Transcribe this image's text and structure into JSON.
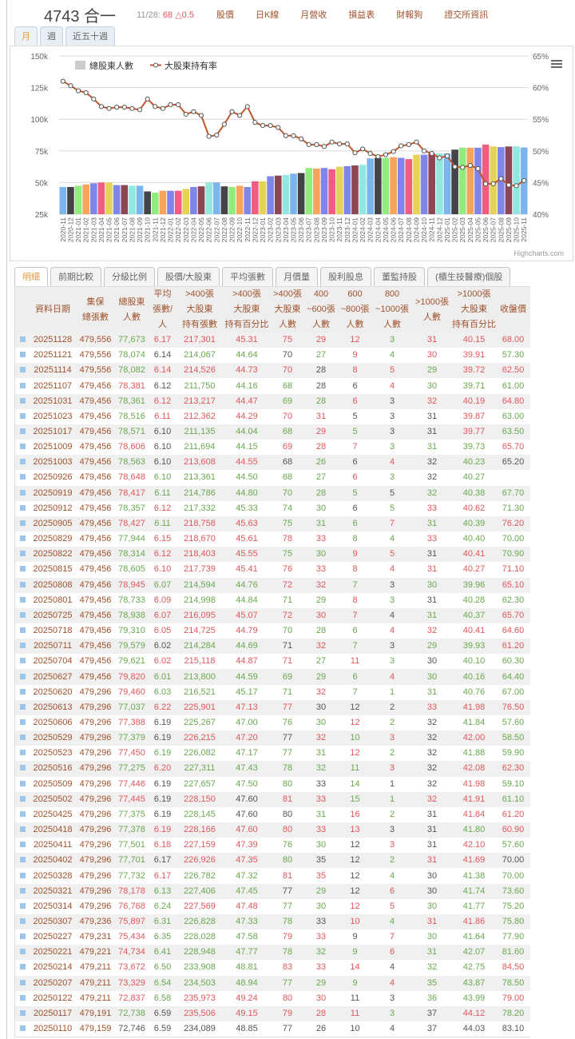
{
  "header": {
    "title": "4743 合一",
    "quote_date": "11/28:",
    "quote_value": "68 △0.5",
    "links": [
      "股價",
      "日K線",
      "月營收",
      "損益表",
      "財報狗",
      "證交所資訊"
    ]
  },
  "period_tabs": [
    {
      "label": "月",
      "active": true
    },
    {
      "label": "週",
      "active": false
    },
    {
      "label": "近五十週",
      "active": false
    }
  ],
  "chart_data": {
    "type": "bar+line",
    "credit": "Highcharts.com",
    "legend": {
      "placement": "top-left",
      "items": [
        "總股東人數",
        "大股東持有率"
      ]
    },
    "line_color": "#c0562c",
    "bar_colors": [
      "#7cb5ec",
      "#434348",
      "#90ed7d",
      "#f7a35c",
      "#8085e9",
      "#f15c80",
      "#e4d354",
      "#8085e8",
      "#8d4653",
      "#91e8e1"
    ],
    "grid": true,
    "y_left": {
      "min": 25000,
      "max": 150000,
      "ticks": [
        "25k",
        "50k",
        "75k",
        "100k",
        "125k",
        "150k"
      ],
      "tick_values": [
        25000,
        50000,
        75000,
        100000,
        125000,
        150000
      ]
    },
    "y_right": {
      "min": 40,
      "max": 65,
      "ticks": [
        "40%",
        "45%",
        "50%",
        "55%",
        "60%",
        "65%"
      ],
      "tick_values": [
        40,
        45,
        50,
        55,
        60,
        65
      ]
    },
    "categories": [
      "2020-11",
      "2020-12",
      "2021-01",
      "2021-02",
      "2021-03",
      "2021-04",
      "2021-05",
      "2021-06",
      "2021-07",
      "2021-08",
      "2021-09",
      "2021-10",
      "2021-11",
      "2021-12",
      "2022-01",
      "2022-02",
      "2022-03",
      "2022-04",
      "2022-05",
      "2022-06",
      "2022-07",
      "2022-08",
      "2022-09",
      "2022-10",
      "2022-11",
      "2022-12",
      "2023-01",
      "2023-02",
      "2023-03",
      "2023-04",
      "2023-05",
      "2023-06",
      "2023-07",
      "2023-08",
      "2023-09",
      "2023-10",
      "2023-11",
      "2023-12",
      "2024-01",
      "2024-02",
      "2024-03",
      "2024-04",
      "2024-05",
      "2024-06",
      "2024-07",
      "2024-08",
      "2024-09",
      "2024-10",
      "2024-11",
      "2024-12",
      "2025-01",
      "2025-02",
      "2025-03",
      "2025-04",
      "2025-05",
      "2025-06",
      "2025-07",
      "2025-08",
      "2025-09",
      "2025-10",
      "2025-11"
    ],
    "series": [
      {
        "name": "總股東人數",
        "type": "bar",
        "axis": "left",
        "values": [
          46500,
          46500,
          47500,
          48500,
          49500,
          50000,
          50000,
          48000,
          48000,
          47500,
          47500,
          43000,
          42000,
          43500,
          43500,
          43500,
          45000,
          46500,
          47000,
          50000,
          50000,
          47000,
          46500,
          47500,
          46500,
          51000,
          51000,
          55000,
          55500,
          56000,
          57000,
          57500,
          61500,
          61000,
          61500,
          60500,
          62500,
          63000,
          63500,
          64000,
          69000,
          69500,
          69500,
          70000,
          69500,
          68500,
          72000,
          72000,
          73000,
          73000,
          73000,
          76000,
          77500,
          77500,
          77500,
          80000,
          78500,
          78000,
          78500,
          78500,
          77673
        ]
      },
      {
        "name": "大股東持有率",
        "type": "line",
        "axis": "right",
        "values": [
          61.0,
          60.3,
          59.5,
          59.2,
          58.2,
          57.0,
          56.7,
          56.9,
          56.9,
          56.7,
          56.5,
          58.2,
          57.0,
          56.7,
          57.3,
          57.3,
          55.8,
          56.2,
          55.6,
          52.3,
          52.5,
          54.2,
          56.2,
          55.6,
          57.0,
          54.5,
          54.0,
          54.0,
          53.7,
          52.4,
          52.4,
          51.9,
          51.0,
          51.0,
          50.7,
          51.4,
          51.1,
          51.1,
          49.7,
          50.3,
          49.6,
          49.1,
          49.4,
          49.9,
          50.8,
          51.0,
          51.4,
          50.0,
          49.6,
          48.9,
          49.2,
          47.5,
          47.4,
          47.7,
          47.2,
          44.8,
          44.8,
          45.6,
          44.6,
          44.5,
          45.31
        ]
      }
    ]
  },
  "table_tabs": [
    {
      "label": "明細",
      "active": true
    },
    {
      "label": "前期比較"
    },
    {
      "label": "分級比例"
    },
    {
      "label": "股價/大股東"
    },
    {
      "label": "平均張數"
    },
    {
      "label": "月價量"
    },
    {
      "label": "股利股息"
    },
    {
      "label": "董監持股"
    },
    {
      "label": "(櫃生技醫療)個股"
    }
  ],
  "table": {
    "columns": [
      "資料日期",
      "集保\n總張數",
      "總股東\n人數",
      "平均\n張數/人",
      ">400張\n大股東\n持有張數",
      ">400張\n大股東\n持有百分比",
      ">400張\n大股東\n人數",
      "400\n~600張\n人數",
      "600\n~800張\n人數",
      "800\n~1000張\n人數",
      ">1000張\n人數",
      ">1000張\n大股東\n持有百分比",
      "收盤價"
    ],
    "rows": [
      [
        "20251128",
        "479,556",
        "77,673",
        "6.17",
        "217,301",
        "45.31",
        "75",
        "29",
        "12",
        "3",
        "31",
        "40.15",
        "68.00"
      ],
      [
        "20251121",
        "479,556",
        "78,074",
        "6.14",
        "214,067",
        "44.64",
        "70",
        "27",
        "9",
        "4",
        "30",
        "39.91",
        "57.30"
      ],
      [
        "20251114",
        "479,556",
        "78,082",
        "6.14",
        "214,526",
        "44.73",
        "70",
        "28",
        "8",
        "5",
        "29",
        "39.72",
        "62.50"
      ],
      [
        "20251107",
        "479,456",
        "78,381",
        "6.12",
        "211,750",
        "44.16",
        "68",
        "28",
        "6",
        "4",
        "30",
        "39.71",
        "61.00"
      ],
      [
        "20251031",
        "479,456",
        "78,361",
        "6.12",
        "213,217",
        "44.47",
        "69",
        "28",
        "6",
        "3",
        "32",
        "40.19",
        "64.80"
      ],
      [
        "20251023",
        "479,456",
        "78,516",
        "6.11",
        "212,362",
        "44.29",
        "70",
        "31",
        "5",
        "3",
        "31",
        "39.87",
        "63.00"
      ],
      [
        "20251017",
        "479,456",
        "78,571",
        "6.10",
        "211,135",
        "44.04",
        "68",
        "29",
        "5",
        "3",
        "31",
        "39.77",
        "63.50"
      ],
      [
        "20251009",
        "479,456",
        "78,606",
        "6.10",
        "211,694",
        "44.15",
        "69",
        "28",
        "7",
        "3",
        "31",
        "39.73",
        "65.70"
      ],
      [
        "20251003",
        "479,456",
        "78,563",
        "6.10",
        "213,608",
        "44.55",
        "68",
        "26",
        "6",
        "4",
        "32",
        "40.23",
        "65.20"
      ],
      [
        "20250926",
        "479,456",
        "78,648",
        "6.10",
        "213,361",
        "44.50",
        "68",
        "27",
        "6",
        "3",
        "32",
        "40.27",
        ""
      ],
      [
        "20250919",
        "479,456",
        "78,417",
        "6.11",
        "214,786",
        "44.80",
        "70",
        "28",
        "5",
        "5",
        "32",
        "40.38",
        "67.70"
      ],
      [
        "20250912",
        "479,456",
        "78,357",
        "6.12",
        "217,332",
        "45.33",
        "74",
        "30",
        "6",
        "5",
        "33",
        "40.62",
        "71.30"
      ],
      [
        "20250905",
        "479,456",
        "78,427",
        "6.11",
        "218,758",
        "45.63",
        "75",
        "31",
        "6",
        "7",
        "31",
        "40.39",
        "76.20"
      ],
      [
        "20250829",
        "479,456",
        "77,944",
        "6.15",
        "218,670",
        "45.61",
        "78",
        "33",
        "8",
        "4",
        "33",
        "40.40",
        "70.00"
      ],
      [
        "20250822",
        "479,456",
        "78,314",
        "6.12",
        "218,403",
        "45.55",
        "75",
        "30",
        "9",
        "5",
        "31",
        "40.41",
        "70.90"
      ],
      [
        "20250815",
        "479,456",
        "78,605",
        "6.10",
        "217,739",
        "45.41",
        "76",
        "33",
        "8",
        "4",
        "31",
        "40.27",
        "71.10"
      ],
      [
        "20250808",
        "479,456",
        "78,945",
        "6.07",
        "214,594",
        "44.76",
        "72",
        "32",
        "7",
        "3",
        "30",
        "39.96",
        "65.10"
      ],
      [
        "20250801",
        "479,456",
        "78,733",
        "6.09",
        "214,998",
        "44.84",
        "71",
        "29",
        "8",
        "3",
        "31",
        "40.28",
        "62.30"
      ],
      [
        "20250725",
        "479,456",
        "78,938",
        "6.07",
        "216,095",
        "45.07",
        "72",
        "30",
        "7",
        "4",
        "31",
        "40.37",
        "65.70"
      ],
      [
        "20250718",
        "479,456",
        "79,310",
        "6.05",
        "214,725",
        "44.79",
        "70",
        "28",
        "6",
        "4",
        "32",
        "40.41",
        "64.60"
      ],
      [
        "20250711",
        "479,456",
        "79,579",
        "6.02",
        "214,284",
        "44.69",
        "71",
        "32",
        "7",
        "3",
        "29",
        "39.93",
        "61.20"
      ],
      [
        "20250704",
        "479,456",
        "79,621",
        "6.02",
        "215,118",
        "44.87",
        "71",
        "27",
        "11",
        "3",
        "30",
        "40.10",
        "60.30"
      ],
      [
        "20250627",
        "479,456",
        "79,820",
        "6.01",
        "213,800",
        "44.59",
        "69",
        "29",
        "6",
        "4",
        "30",
        "40.16",
        "64.40"
      ],
      [
        "20250620",
        "479,296",
        "79,460",
        "6.03",
        "216,521",
        "45.17",
        "71",
        "32",
        "7",
        "1",
        "31",
        "40.76",
        "67.00"
      ],
      [
        "20250613",
        "479,296",
        "77,037",
        "6.22",
        "225,901",
        "47.13",
        "77",
        "30",
        "12",
        "2",
        "33",
        "41.98",
        "76.50"
      ],
      [
        "20250606",
        "479,296",
        "77,388",
        "6.19",
        "225,267",
        "47.00",
        "76",
        "30",
        "12",
        "2",
        "32",
        "41.84",
        "57.60"
      ],
      [
        "20250529",
        "479,296",
        "77,379",
        "6.19",
        "226,215",
        "47.20",
        "77",
        "32",
        "10",
        "3",
        "32",
        "42.00",
        "58.50"
      ],
      [
        "20250523",
        "479,296",
        "77,450",
        "6.19",
        "226,082",
        "47.17",
        "77",
        "31",
        "12",
        "2",
        "32",
        "41.88",
        "59.90"
      ],
      [
        "20250516",
        "479,296",
        "77,275",
        "6.20",
        "227,311",
        "47.43",
        "78",
        "32",
        "11",
        "3",
        "32",
        "42.08",
        "62.30"
      ],
      [
        "20250509",
        "479,296",
        "77,446",
        "6.19",
        "227,657",
        "47.50",
        "80",
        "33",
        "14",
        "1",
        "32",
        "41.98",
        "59.10"
      ],
      [
        "20250502",
        "479,296",
        "77,445",
        "6.19",
        "228,150",
        "47.60",
        "81",
        "33",
        "15",
        "1",
        "32",
        "41.91",
        "61.10"
      ],
      [
        "20250425",
        "479,296",
        "77,375",
        "6.19",
        "228,145",
        "47.60",
        "80",
        "31",
        "16",
        "2",
        "31",
        "41.84",
        "61.20"
      ],
      [
        "20250418",
        "479,296",
        "77,378",
        "6.19",
        "228,166",
        "47.60",
        "80",
        "33",
        "13",
        "3",
        "31",
        "41.80",
        "60.90"
      ],
      [
        "20250411",
        "479,296",
        "77,501",
        "6.18",
        "227,159",
        "47.39",
        "76",
        "30",
        "12",
        "3",
        "31",
        "42.10",
        "57.60"
      ],
      [
        "20250402",
        "479,296",
        "77,701",
        "6.17",
        "226,926",
        "47.35",
        "80",
        "35",
        "12",
        "2",
        "31",
        "41.69",
        "70.00"
      ],
      [
        "20250328",
        "479,296",
        "77,732",
        "6.17",
        "226,782",
        "47.32",
        "81",
        "35",
        "12",
        "4",
        "30",
        "41.38",
        "70.00"
      ],
      [
        "20250321",
        "479,296",
        "78,178",
        "6.13",
        "227,406",
        "47.45",
        "77",
        "29",
        "12",
        "6",
        "30",
        "41.74",
        "73.60"
      ],
      [
        "20250314",
        "479,296",
        "76,768",
        "6.24",
        "227,569",
        "47.48",
        "77",
        "30",
        "12",
        "5",
        "30",
        "41.77",
        "75.20"
      ],
      [
        "20250307",
        "479,236",
        "75,897",
        "6.31",
        "226,828",
        "47.33",
        "78",
        "33",
        "10",
        "4",
        "31",
        "41.86",
        "75.80"
      ],
      [
        "20250227",
        "479,231",
        "75,434",
        "6.35",
        "228,028",
        "47.58",
        "79",
        "33",
        "9",
        "7",
        "30",
        "41.64",
        "77.90"
      ],
      [
        "20250221",
        "479,221",
        "74,734",
        "6.41",
        "228,948",
        "47.77",
        "78",
        "32",
        "9",
        "6",
        "31",
        "42.07",
        "81.60"
      ],
      [
        "20250214",
        "479,211",
        "73,672",
        "6.50",
        "233,908",
        "48.81",
        "83",
        "33",
        "14",
        "4",
        "32",
        "42.75",
        "84.50"
      ],
      [
        "20250207",
        "479,211",
        "73,329",
        "6.54",
        "234,503",
        "48.94",
        "77",
        "29",
        "9",
        "4",
        "35",
        "43.87",
        "78.50"
      ],
      [
        "20250122",
        "479,211",
        "72,837",
        "6.58",
        "235,973",
        "49.24",
        "80",
        "30",
        "11",
        "3",
        "36",
        "43.99",
        "79.00"
      ],
      [
        "20250117",
        "479,191",
        "72,738",
        "6.59",
        "235,506",
        "49.15",
        "79",
        "28",
        "11",
        "3",
        "37",
        "44.12",
        "78.20"
      ],
      [
        "20250110",
        "479,159",
        "72,746",
        "6.59",
        "234,089",
        "48.85",
        "77",
        "26",
        "10",
        "4",
        "37",
        "44.03",
        "83.10"
      ]
    ]
  }
}
